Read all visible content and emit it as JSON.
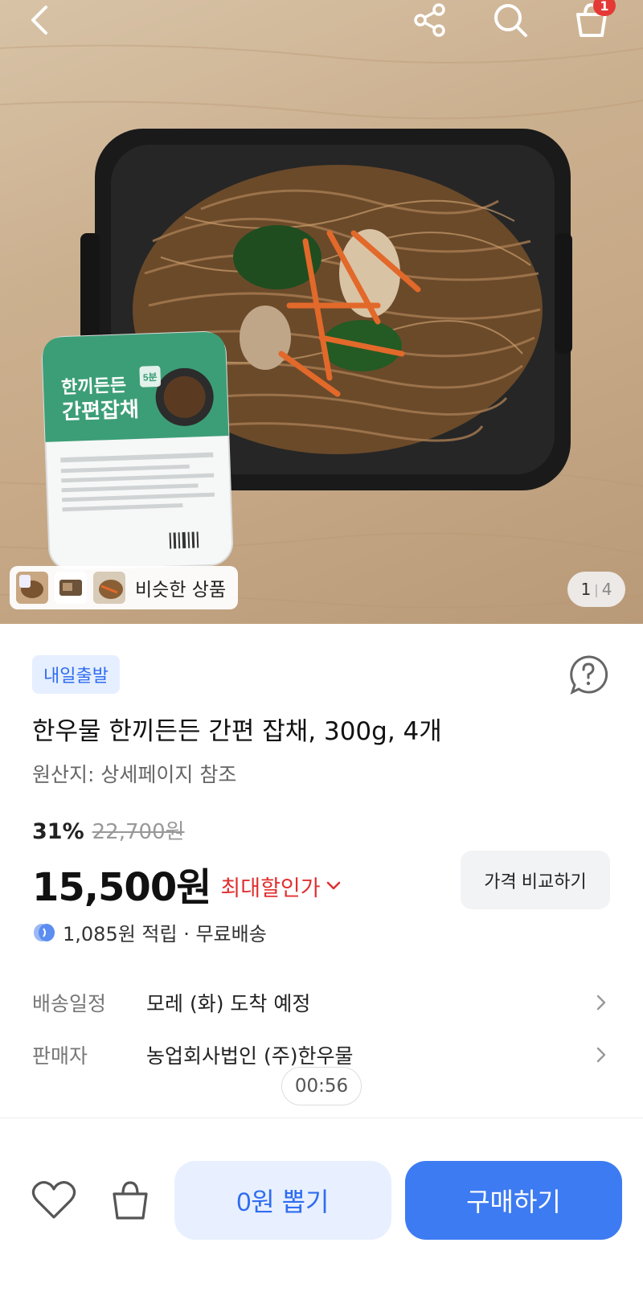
{
  "header": {
    "back_icon": "chevron-left-icon",
    "share_icon": "share-icon",
    "search_icon": "search-icon",
    "cart_icon": "shopping-bag-icon",
    "cart_badge": "1"
  },
  "gallery": {
    "similar_label": "비슷한 상품",
    "page_current": "1",
    "page_total": "4",
    "package": {
      "brand_line": "한끼든든",
      "name_line": "간편잡채",
      "minutes": "5분"
    }
  },
  "product": {
    "delivery_badge": "내일출발",
    "title": "한우물 한끼든든 간편 잡채, 300g, 4개",
    "origin": "원산지: 상세페이지 참조",
    "discount_percent": "31%",
    "original_price": "22,700원",
    "price": "15,500원",
    "max_discount_label": "최대할인가",
    "compare_label": "가격 비교하기",
    "reward_text": "1,085원 적립 · 무료배송"
  },
  "info_rows": {
    "shipping_label": "배송일정",
    "shipping_value": "모레 (화) 도착 예정",
    "seller_label": "판매자",
    "seller_value": "농업회사법인 (주)한우물"
  },
  "timer": "00:56",
  "bottom_bar": {
    "draw_label": "0원 뽑기",
    "buy_label": "구매하기"
  },
  "colors": {
    "accent": "#3d7bf2",
    "discount_red": "#e03131",
    "badge_bg": "#e6efff"
  }
}
